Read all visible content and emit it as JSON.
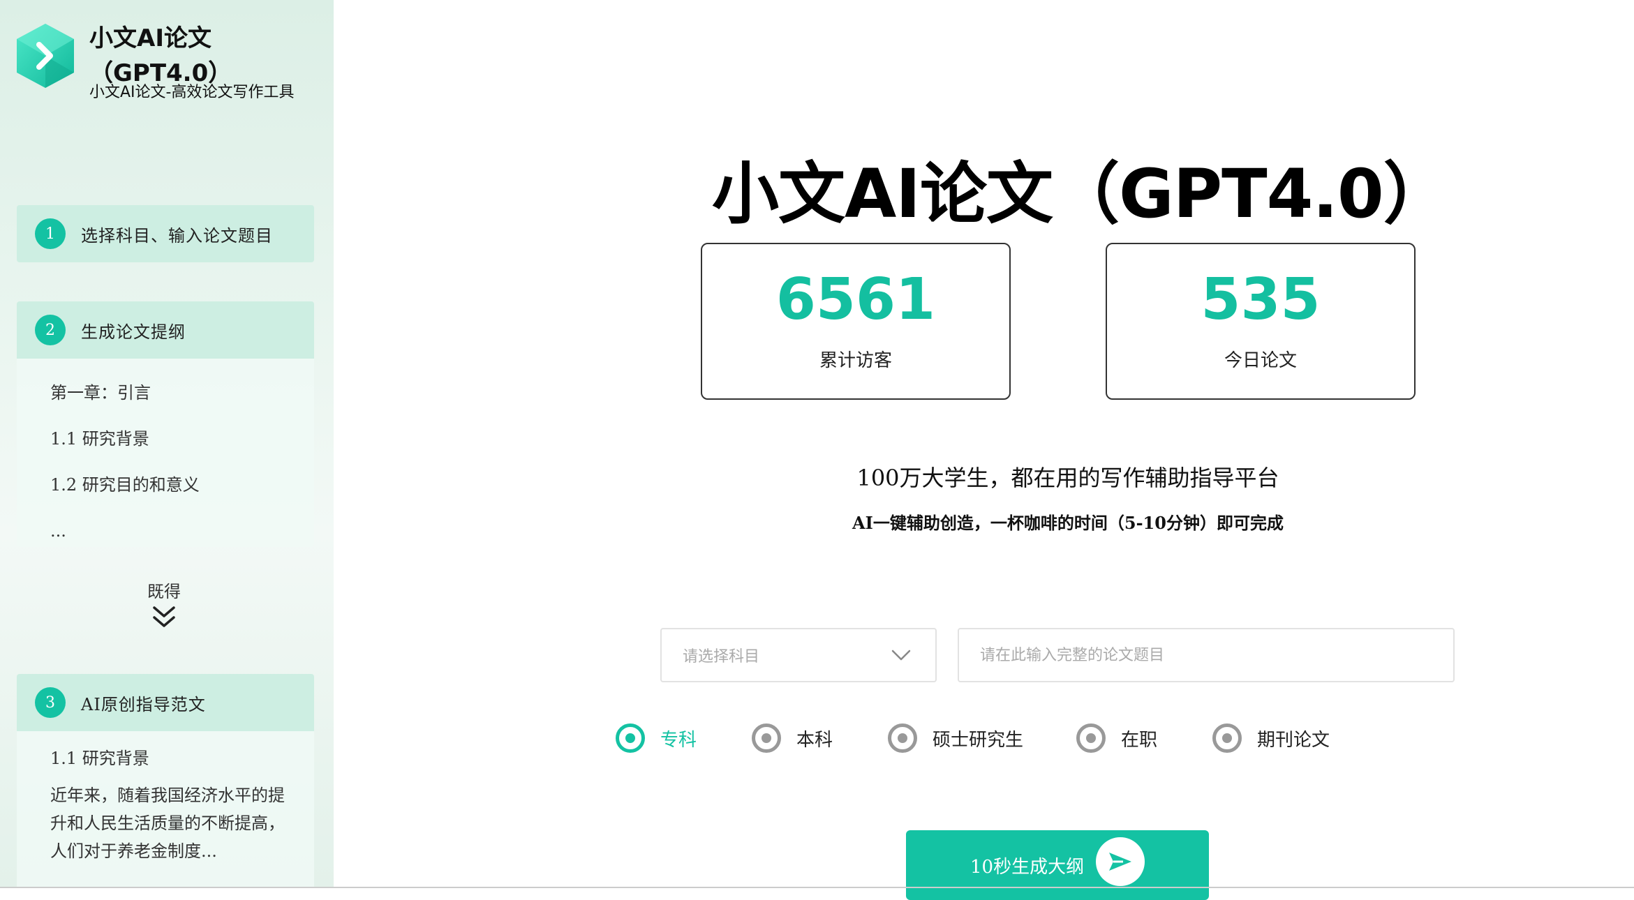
{
  "brand": {
    "title": "小文AI论文（GPT4.0）",
    "subtitle": "小文AI论文-高效论文写作工具",
    "logo_icon": "chevron-right-hexagon-logo"
  },
  "sidebar": {
    "steps": [
      {
        "num": "1",
        "label": "选择科目、输入论文题目"
      },
      {
        "num": "2",
        "label": "生成论文提纲",
        "lines": [
          "第一章：引言",
          "1.1 研究背景",
          "1.2 研究目的和意义",
          "..."
        ]
      },
      {
        "num": "3",
        "label": "AI原创指导范文",
        "lines": [
          "1.1 研究背景"
        ],
        "paragraph": "近年来，随着我国经济水平的提升和人民生活质量的不断提高，人们对于养老金制度..."
      }
    ],
    "arrow_text": "既得",
    "arrow_icon": "double-chevron-down-icon"
  },
  "hero": {
    "title": "小文AI论文（GPT4.0）"
  },
  "stats": [
    {
      "value": "6561",
      "label": "累计访客"
    },
    {
      "value": "535",
      "label": "今日论文"
    }
  ],
  "tagline": "100万大学生，都在用的写作辅助指导平台",
  "tagline2": "AI一键辅助创造，一杯咖啡的时间（5-10分钟）即可完成",
  "form": {
    "subject_placeholder": "请选择科目",
    "title_placeholder": "请在此输入完整的论文题目",
    "levels": [
      "专科",
      "本科",
      "硕士研究生",
      "在职",
      "期刊论文"
    ],
    "selected_level": "专科",
    "submit_label": "10秒生成大纲",
    "submit_icon": "send-arrow-icon"
  },
  "colors": {
    "accent": "#14c2a3",
    "sidebar_bg": "#e3f1ea",
    "step_head_bg": "#cdeee2"
  }
}
